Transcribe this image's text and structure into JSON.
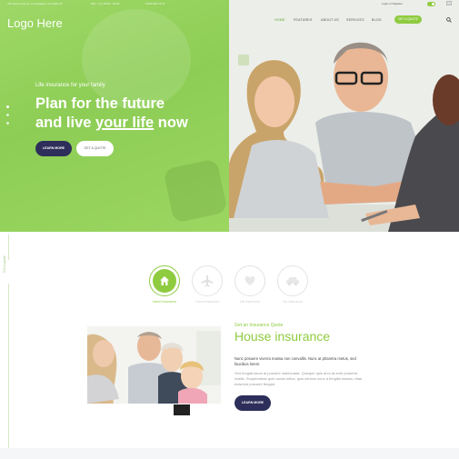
{
  "topbar": {
    "address": "726 Some Avenue, Los Angeles, CA 1000 US",
    "hours": "Mon - Fri: 08:00 - 19:00",
    "phone": "8 800 000 16 47",
    "login": "Login or Register"
  },
  "header": {
    "logo": "Logo Here",
    "nav": [
      {
        "label": "HOME"
      },
      {
        "label": "FEATURES"
      },
      {
        "label": "ABOUT US"
      },
      {
        "label": "SERVICES"
      },
      {
        "label": "BLOG"
      }
    ],
    "quote_button": "GET A QUOTE"
  },
  "hero": {
    "eyebrow": "Life insurance for your family",
    "headline_line1": "Plan for the future",
    "headline_line2_pre": "and live ",
    "headline_line2_underlined": "your life",
    "headline_line2_post": " now",
    "learn_more": "LEARN MORE",
    "get_quote": "GET A QUOTE"
  },
  "side_label": "Get a quote",
  "tabs": [
    {
      "label": "Home Insurance",
      "icon": "home-icon",
      "active": true
    },
    {
      "label": "Travel Insurance",
      "icon": "airplane-icon",
      "active": false
    },
    {
      "label": "Life Insurance",
      "icon": "heart-icon",
      "active": false
    },
    {
      "label": "Car Insurance",
      "icon": "car-icon",
      "active": false
    }
  ],
  "content": {
    "kicker": "Get an Insurance Quote",
    "title": "House insurance",
    "lead": "Nunc posuere viverra massa non convallis. Nunc at pharetra metus, sed faucibus lorem.",
    "body": "Sed feugiat lacus at posuere malesuada. Quisque quis arcu at ante pharetra mattis. Suspendisse quis varius tellus, quis ultrices nunc a fringilla massa, vitae euismod posuere feugiat.",
    "learn_more": "LEARN MORE"
  },
  "colors": {
    "accent": "#8ecb3f",
    "dark_button": "#2d2f5a"
  }
}
